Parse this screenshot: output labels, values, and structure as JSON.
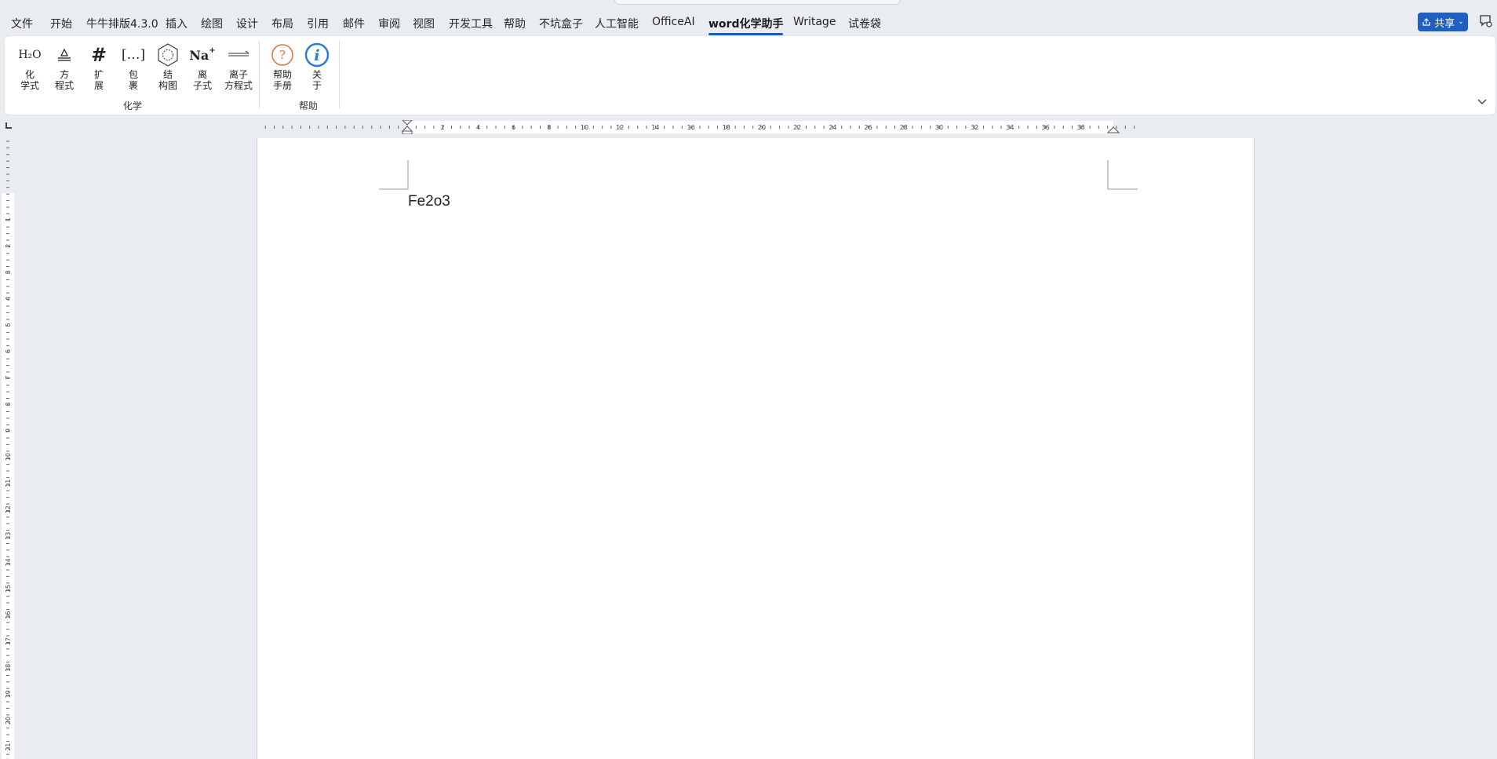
{
  "menu": {
    "tabs": [
      {
        "label": "文件"
      },
      {
        "label": "开始"
      },
      {
        "label": "牛牛排版4.3.0"
      },
      {
        "label": "插入"
      },
      {
        "label": "绘图"
      },
      {
        "label": "设计"
      },
      {
        "label": "布局"
      },
      {
        "label": "引用"
      },
      {
        "label": "邮件"
      },
      {
        "label": "审阅"
      },
      {
        "label": "视图"
      },
      {
        "label": "开发工具"
      },
      {
        "label": "帮助"
      },
      {
        "label": "不坑盒子"
      },
      {
        "label": "人工智能"
      },
      {
        "label": "OfficeAI"
      },
      {
        "label": "word化学助手",
        "active": true
      },
      {
        "label": "Writage"
      },
      {
        "label": "试卷袋"
      }
    ],
    "share_label": "共享"
  },
  "ribbon": {
    "chem_group": {
      "label": "化学",
      "buttons": [
        {
          "icon": "formula-h2o-icon",
          "icon_text": "H₂O",
          "label1": "化",
          "label2": "学式"
        },
        {
          "icon": "equation-icon",
          "label1": "方",
          "label2": "程式"
        },
        {
          "icon": "hash-expand-icon",
          "icon_text": "#",
          "label1": "扩",
          "label2": "展"
        },
        {
          "icon": "bracket-wrap-icon",
          "icon_text": "[…]",
          "label1": "包",
          "label2": "裹"
        },
        {
          "icon": "benzene-structure-icon",
          "label1": "结",
          "label2": "构图"
        },
        {
          "icon": "ion-na-icon",
          "icon_text": "Na",
          "icon_sup": "+",
          "label1": "离",
          "label2": "子式"
        },
        {
          "icon": "ionic-equation-icon",
          "label1": "离子",
          "label2": "方程式"
        }
      ]
    },
    "help_group": {
      "label": "帮助",
      "buttons": [
        {
          "icon": "help-question-icon",
          "icon_text": "?",
          "label1": "帮助",
          "label2": "手册"
        },
        {
          "icon": "info-icon",
          "icon_text": "i",
          "label1": "关",
          "label2": "于"
        }
      ]
    }
  },
  "ruler": {
    "h_labels": [
      "2",
      "4",
      "6",
      "8",
      "10",
      "12",
      "14",
      "16",
      "18",
      "20",
      "22",
      "24",
      "26",
      "28",
      "30",
      "32",
      "34",
      "36",
      "38"
    ],
    "v_labels": [
      "1",
      "2",
      "3",
      "4",
      "5",
      "6",
      "7",
      "8",
      "9",
      "10",
      "11",
      "12",
      "13",
      "14",
      "15",
      "16",
      "17",
      "18",
      "19",
      "20",
      "21"
    ]
  },
  "document": {
    "text": "Fe2o3"
  },
  "colors": {
    "accent": "#1f5fbf",
    "help_orange": "#e0703a",
    "info_blue": "#2b7bd6"
  }
}
